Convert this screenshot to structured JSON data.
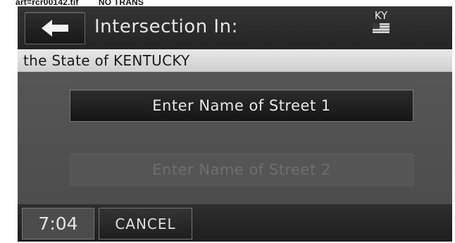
{
  "caption": "art=rcr00142.tif        NO TRANS",
  "header": {
    "title": "Intersection In:",
    "back_icon": "left-arrow-icon",
    "state_code": "KY",
    "flag_icon": "us-flag-icon"
  },
  "location": {
    "text": "the State of KENTUCKY"
  },
  "buttons": {
    "street1_label": "Enter Name of Street 1",
    "street2_label": "Enter Name of Street 2"
  },
  "footer": {
    "clock": "7:04",
    "cancel_label": "CANCEL"
  }
}
